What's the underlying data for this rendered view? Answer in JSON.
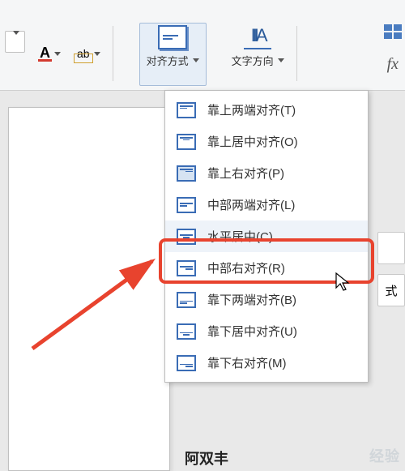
{
  "ribbon": {
    "font_color_label": "A",
    "highlight_label": "ab",
    "align_button_label": "对齐方式",
    "text_direction_label": "文字方向",
    "text_direction_glyph": "IIIA",
    "fx_label": "fx"
  },
  "menu": {
    "items": [
      {
        "label": "靠上两端对齐(T)"
      },
      {
        "label": "靠上居中对齐(O)"
      },
      {
        "label": "靠上右对齐(P)"
      },
      {
        "label": "中部两端对齐(L)"
      },
      {
        "label": "水平居中(C)"
      },
      {
        "label": "中部右对齐(R)"
      },
      {
        "label": "靠下两端对齐(B)"
      },
      {
        "label": "靠下居中对齐(U)"
      },
      {
        "label": "靠下右对齐(M)"
      }
    ]
  },
  "side": {
    "label1": "式"
  },
  "bottom": {
    "text": "阿双丰"
  },
  "watermark": "经验"
}
